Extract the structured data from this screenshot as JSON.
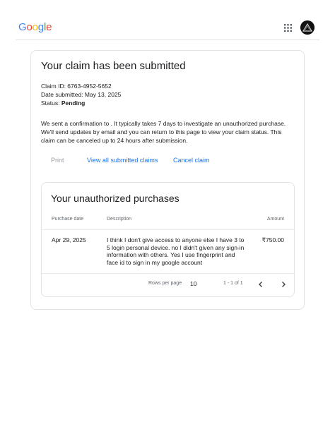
{
  "header": {
    "logo_letters": [
      {
        "char": "G",
        "color": "#4285F4"
      },
      {
        "char": "o",
        "color": "#EA4335"
      },
      {
        "char": "o",
        "color": "#FBBC05"
      },
      {
        "char": "g",
        "color": "#4285F4"
      },
      {
        "char": "l",
        "color": "#34A853"
      },
      {
        "char": "e",
        "color": "#EA4335"
      }
    ],
    "apps_icon": "google-apps-grid-icon",
    "avatar_icon": "account-avatar-icon"
  },
  "claim": {
    "title": "Your claim has been submitted",
    "claim_id": "Claim ID: 6763-4952-5652",
    "date_submitted": "Date submitted: May 13, 2025",
    "status_prefix": "Status: ",
    "status_value": "Pending",
    "paragraph": "We sent a confirmation to . It typically takes 7 days to investigate an unauthorized purchase. We'll send updates by email and you can return to this page to view your claim status. This claim can be canceled up to 24 hours after submission."
  },
  "actions": {
    "print": "Print",
    "view_all": "View all submitted claims",
    "cancel": "Cancel claim"
  },
  "purchases": {
    "title": "Your unauthorized purchases",
    "columns": [
      "Purchase date",
      "Description",
      "Amount"
    ],
    "rows": [
      {
        "date": "Apr 29, 2025",
        "description": "I think I don't give access to anyone else I have 3 to 5 login personal device. no I didn't given any sign-in information with others. Yes I use fingerprint and face id to sign in my google account",
        "amount": "₹750.00"
      }
    ],
    "pagination": {
      "rows_per_page_label": "Rows per page",
      "rows_per_page_value": "10",
      "range": "1 - 1 of 1",
      "prev_icon": "chevron-left-icon",
      "next_icon": "chevron-right-icon"
    }
  },
  "colors": {
    "link": "#1a73e8",
    "disabled": "#9aa0a6",
    "border": "#e3e3e3"
  }
}
